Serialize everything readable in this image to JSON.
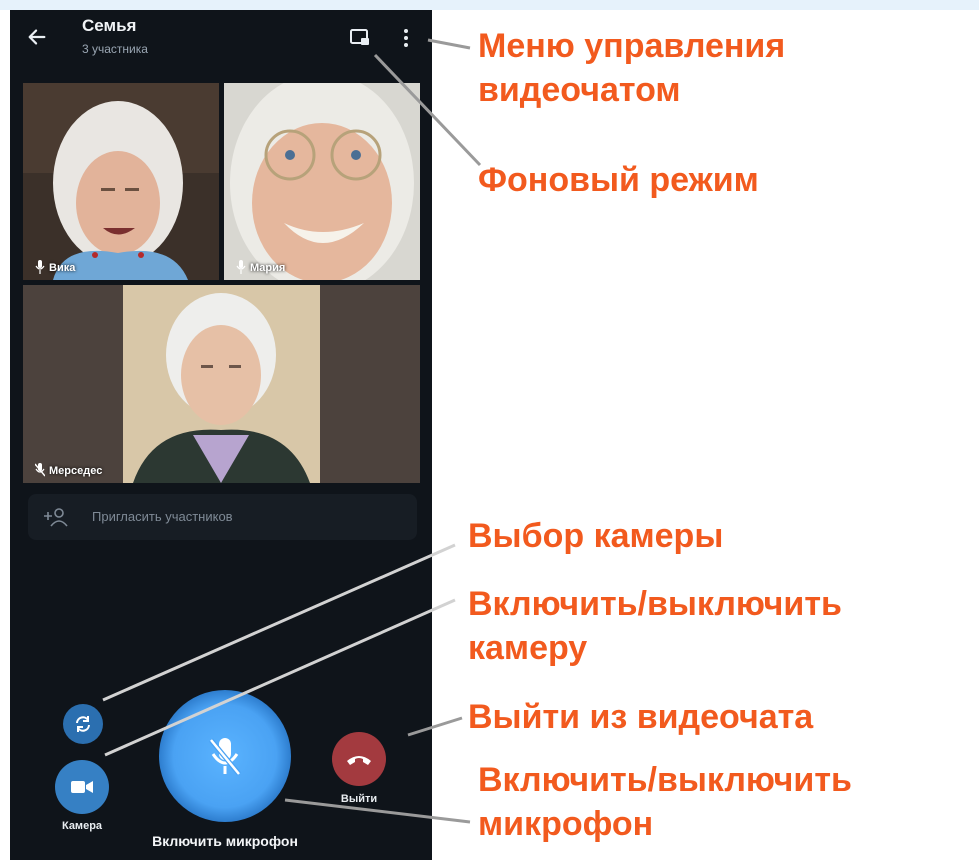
{
  "header": {
    "title": "Семья",
    "subtitle": "3 участника"
  },
  "participants": [
    {
      "name": "Вика",
      "mic": "on"
    },
    {
      "name": "Мария",
      "mic": "on"
    },
    {
      "name": "Мерседес",
      "mic": "muted"
    }
  ],
  "invite": {
    "label": "Пригласить участников"
  },
  "controls": {
    "camera_label": "Камера",
    "mic_label": "Включить микрофон",
    "exit_label": "Выйти"
  },
  "annotations": {
    "menu": [
      "Меню управления",
      "видеочатом"
    ],
    "background_mode": "Фоновый режим",
    "camera_select": "Выбор камеры",
    "camera_toggle": [
      "Включить/выключить",
      "камеру"
    ],
    "exit": "Выйти из видеочата",
    "mic_toggle": [
      "Включить/выключить",
      "микрофон"
    ]
  },
  "colors": {
    "annotation": "#f25a1e",
    "background": "#0f141a",
    "mic_button": "#4aa2f3",
    "exit_button": "#a33a3f",
    "camera_button": "#3680c4"
  },
  "icons": [
    "back-arrow-icon",
    "pip-icon",
    "more-vertical-icon",
    "mic-icon",
    "mic-off-icon",
    "add-person-icon",
    "camera-flip-icon",
    "video-camera-icon",
    "hang-up-icon"
  ]
}
